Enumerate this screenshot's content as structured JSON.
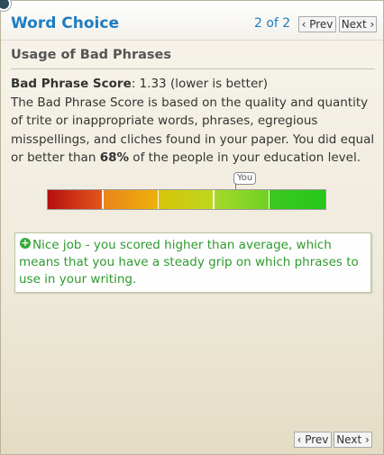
{
  "header": {
    "title": "Word Choice",
    "page_count": "2 of 2",
    "prev_label": "‹ Prev",
    "next_label": "Next ›"
  },
  "section": {
    "subtitle": "Usage of Bad Phrases",
    "score_label": "Bad Phrase Score",
    "score_value": ": 1.33 (lower is better)",
    "description_pre": "The Bad Phrase Score is based on the quality and quantity of trite or inappropriate words, phrases, egregious misspellings, and cliches found in your paper. You did equal or better than ",
    "percent": "68%",
    "description_post": " of the people in your education level."
  },
  "meter": {
    "you_label": "You",
    "position_fraction": 0.68,
    "segment_colors": [
      "#c21c12",
      "#ee9a08",
      "#d8c902",
      "#8fd42a",
      "#27c41d"
    ]
  },
  "feedback": {
    "icon": "plus-circle-icon",
    "text": "Nice job - you scored higher than average, which means that you have a steady grip on which phrases to use in your writing."
  },
  "footer": {
    "prev_label": "‹ Prev",
    "next_label": "Next ›"
  }
}
